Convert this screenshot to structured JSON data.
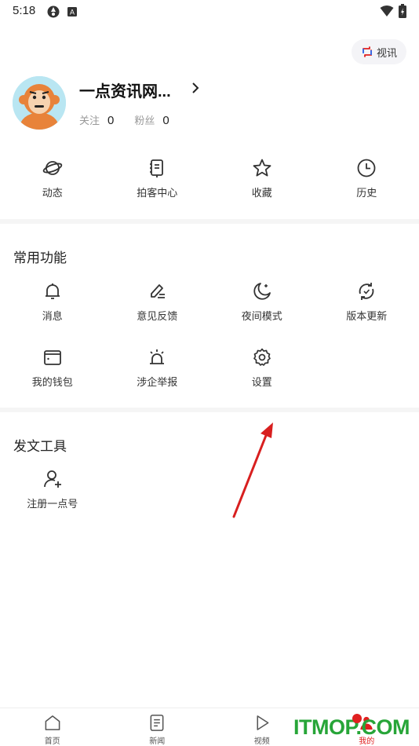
{
  "status_bar": {
    "time": "5:18"
  },
  "header": {
    "video_button_label": "视讯"
  },
  "profile": {
    "name": "一点资讯网...",
    "following_label": "关注",
    "following_count": "0",
    "followers_label": "粉丝",
    "followers_count": "0"
  },
  "quick_actions": [
    {
      "label": "动态",
      "icon": "planet-icon"
    },
    {
      "label": "拍客中心",
      "icon": "notebook-icon"
    },
    {
      "label": "收藏",
      "icon": "star-icon"
    },
    {
      "label": "历史",
      "icon": "clock-icon"
    }
  ],
  "common_functions": {
    "title": "常用功能",
    "items": [
      {
        "label": "消息",
        "icon": "bell-icon"
      },
      {
        "label": "意见反馈",
        "icon": "edit-icon"
      },
      {
        "label": "夜间模式",
        "icon": "moon-icon"
      },
      {
        "label": "版本更新",
        "icon": "refresh-icon"
      },
      {
        "label": "我的钱包",
        "icon": "wallet-icon"
      },
      {
        "label": "涉企举报",
        "icon": "alarm-icon"
      },
      {
        "label": "设置",
        "icon": "gear-icon"
      }
    ]
  },
  "writing_tools": {
    "title": "发文工具",
    "items": [
      {
        "label": "注册一点号",
        "icon": "add-user-icon"
      }
    ]
  },
  "bottom_nav": [
    {
      "label": "首页",
      "icon": "home-icon"
    },
    {
      "label": "新闻",
      "icon": "news-icon"
    },
    {
      "label": "视频",
      "icon": "play-icon"
    },
    {
      "label": "我的",
      "icon": "user-icon"
    }
  ],
  "watermark": {
    "text": "ITMOP.COM"
  },
  "colors": {
    "accent": "#e02020",
    "watermark": "#27a538",
    "divider": "#f5f5f5"
  }
}
